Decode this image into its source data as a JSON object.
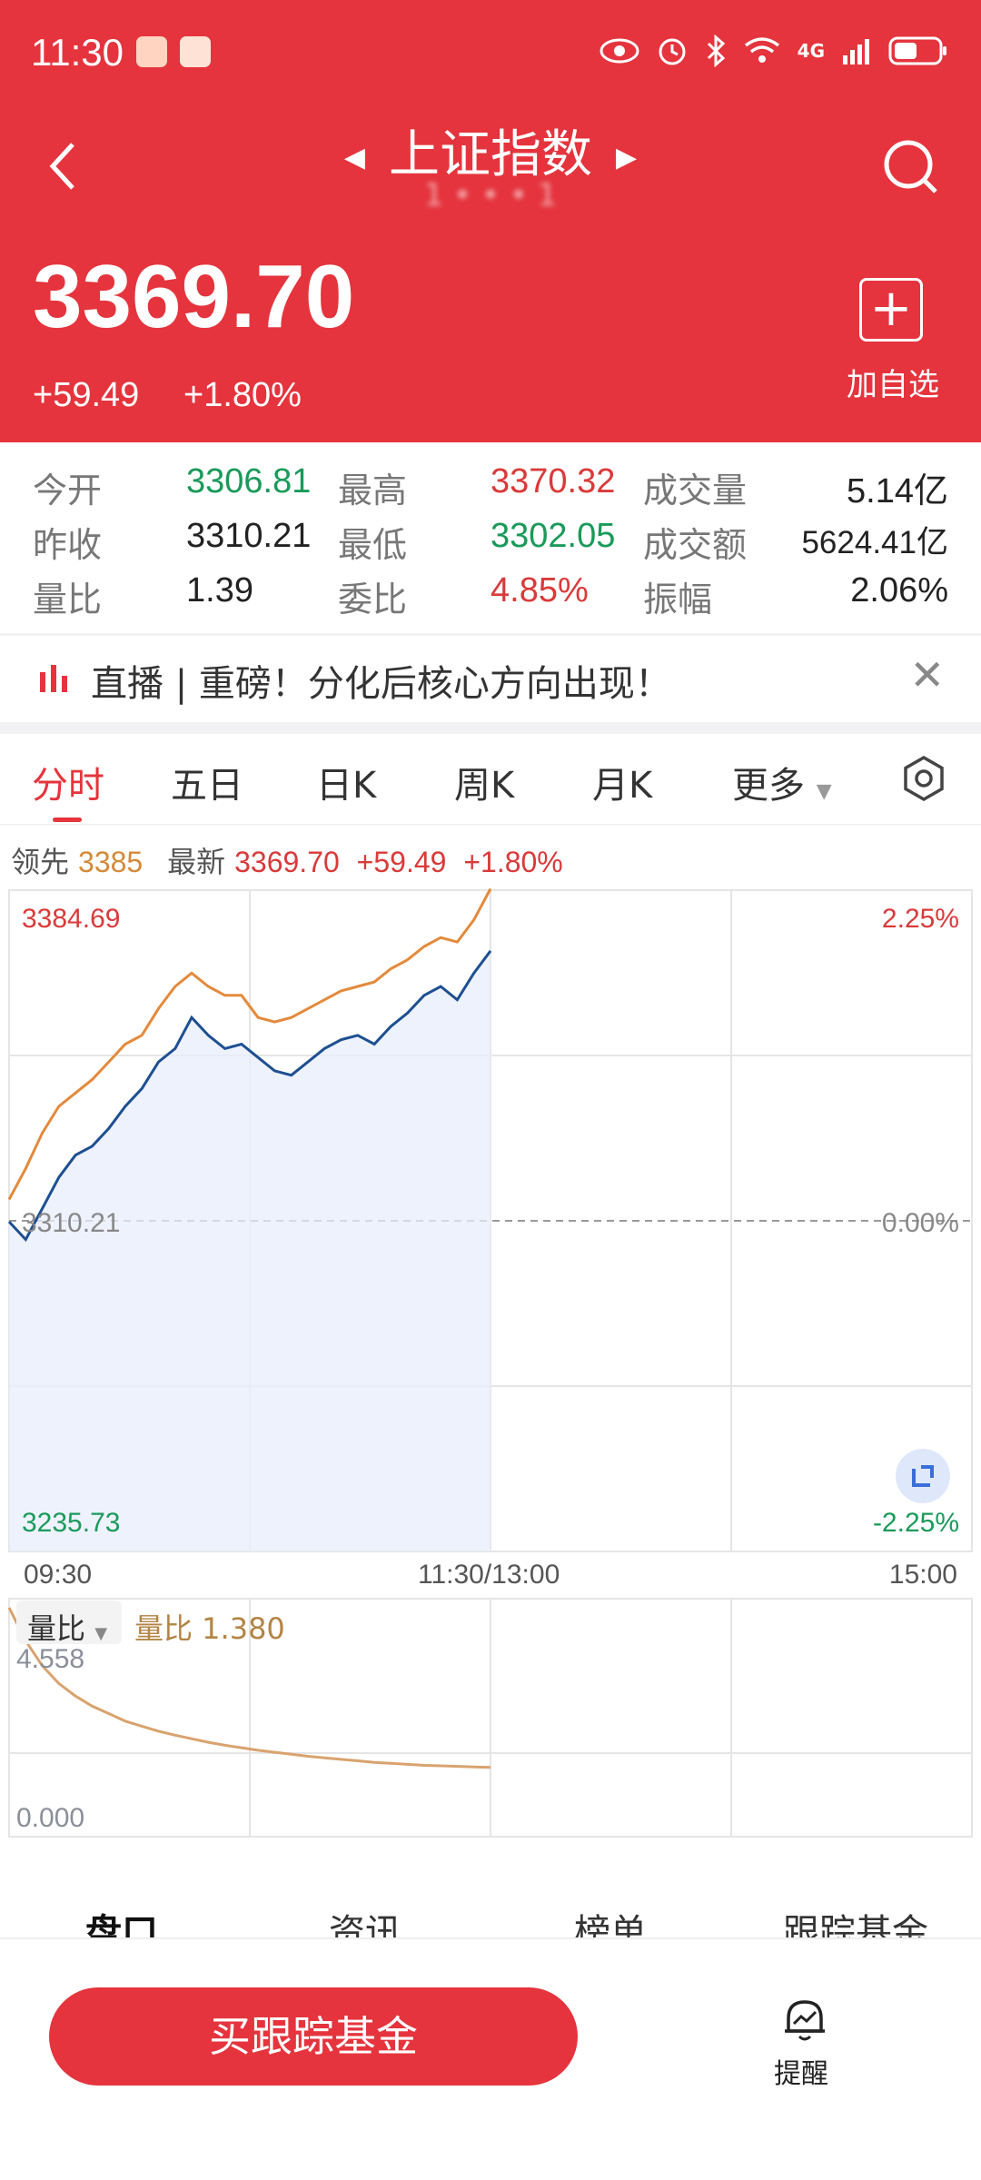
{
  "status_bar": {
    "time": "11:30",
    "network": "4G"
  },
  "header": {
    "title": "上证指数",
    "code": "1 • • • 1",
    "price": "3369.70",
    "change": "+59.49",
    "change_pct": "+1.80%",
    "add_label": "加自选"
  },
  "stats": [
    {
      "label": "今开",
      "value": "3306.81",
      "color": "green"
    },
    {
      "label": "最高",
      "value": "3370.32",
      "color": "red"
    },
    {
      "label": "成交量",
      "value": "5.14亿",
      "color": "dark"
    },
    {
      "label": "昨收",
      "value": "3310.21",
      "color": "dark"
    },
    {
      "label": "最低",
      "value": "3302.05",
      "color": "green"
    },
    {
      "label": "成交额",
      "value": "5624.41亿",
      "color": "dark"
    },
    {
      "label": "量比",
      "value": "1.39",
      "color": "dark"
    },
    {
      "label": "委比",
      "value": "4.85%",
      "color": "red"
    },
    {
      "label": "振幅",
      "value": "2.06%",
      "color": "dark"
    }
  ],
  "banner": {
    "text": "直播 | 重磅！分化后核心方向出现！"
  },
  "chart_tabs": [
    "分时",
    "五日",
    "日K",
    "周K",
    "月K",
    "更多"
  ],
  "quote_line": {
    "lead_label": "领先",
    "lead_value": "3385",
    "latest_label": "最新",
    "latest_value": "3369.70",
    "change": "+59.49",
    "pct": "+1.80%"
  },
  "chart_data": {
    "type": "line",
    "y_max_label": "3384.69",
    "y_mid_label": "3310.21",
    "y_min_label": "3235.73",
    "pct_max_label": "2.25%",
    "pct_mid_label": "0.00%",
    "pct_min_label": "-2.25%",
    "ylim": [
      3235.73,
      3384.69
    ],
    "x_labels": [
      "09:30",
      "11:30/13:00",
      "15:00"
    ],
    "series": [
      {
        "name": "最新",
        "color": "#1d4f91",
        "values": [
          3310.0,
          3306.0,
          3313.0,
          3320.0,
          3325.0,
          3327.0,
          3331.0,
          3336.0,
          3340.0,
          3346.0,
          3349.0,
          3356.0,
          3352.0,
          3349.0,
          3350.0,
          3347.0,
          3344.0,
          3343.0,
          3346.0,
          3349.0,
          3351.0,
          3352.0,
          3350.0,
          3354.0,
          3357.0,
          3361.0,
          3363.0,
          3360.0,
          3366.0,
          3371.0
        ]
      },
      {
        "name": "领先",
        "color": "#e38a3c",
        "values": [
          3315.0,
          3322.0,
          3330.0,
          3336.0,
          3339.0,
          3342.0,
          3346.0,
          3350.0,
          3352.0,
          3358.0,
          3363.0,
          3366.0,
          3363.0,
          3361.0,
          3361.0,
          3356.0,
          3355.0,
          3356.0,
          3358.0,
          3360.0,
          3362.0,
          3363.0,
          3364.0,
          3367.0,
          3369.0,
          3372.0,
          3374.0,
          3373.0,
          3378.0,
          3385.0
        ]
      }
    ]
  },
  "volume": {
    "pill_label": "量比",
    "title": "量比 1.380",
    "max_label": "4.558",
    "min_label": "0.000",
    "values": [
      4.56,
      3.9,
      3.4,
      3.05,
      2.8,
      2.6,
      2.45,
      2.3,
      2.2,
      2.1,
      2.02,
      1.95,
      1.88,
      1.82,
      1.77,
      1.72,
      1.68,
      1.64,
      1.6,
      1.57,
      1.54,
      1.51,
      1.48,
      1.46,
      1.44,
      1.42,
      1.41,
      1.4,
      1.39,
      1.38
    ]
  },
  "bottom_tabs": [
    "盘口",
    "资讯",
    "榜单",
    "跟踪基金"
  ],
  "buy_button": "买跟踪基金",
  "remind_label": "提醒"
}
